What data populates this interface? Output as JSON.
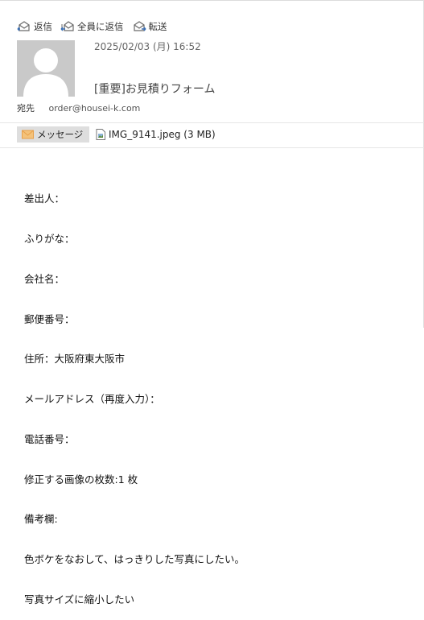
{
  "toolbar": {
    "reply_label": "返信",
    "reply_all_label": "全員に返信",
    "forward_label": "転送"
  },
  "header": {
    "date": "2025/02/03 (月) 16:52",
    "subject": "[重要]お見積りフォーム",
    "to_label": "宛先",
    "to_address": "order@housei-k.com"
  },
  "tabs": {
    "message_label": "メッセージ",
    "attachment_label": "IMG_9141.jpeg (3 MB)"
  },
  "body": {
    "lines": [
      "差出人：",
      "ふりがな：",
      "会社名：",
      "郵便番号：",
      "住所：大阪府東大阪市",
      "メールアドレス（再度入力）：",
      "電話番号：",
      "修正する画像の枚数:1 枚",
      "備考欄:",
      "色ボケをなおして、はっきりした写真にしたい。",
      "写真サイズに縮小したい"
    ]
  },
  "colors": {
    "avatar_bg": "#c9c9c9",
    "tab_bg": "#dedede",
    "envelope_icon": "#e8a04a"
  },
  "icons": [
    "reply-icon",
    "reply-all-icon",
    "forward-icon",
    "avatar-silhouette",
    "envelope-icon",
    "image-file-icon"
  ]
}
